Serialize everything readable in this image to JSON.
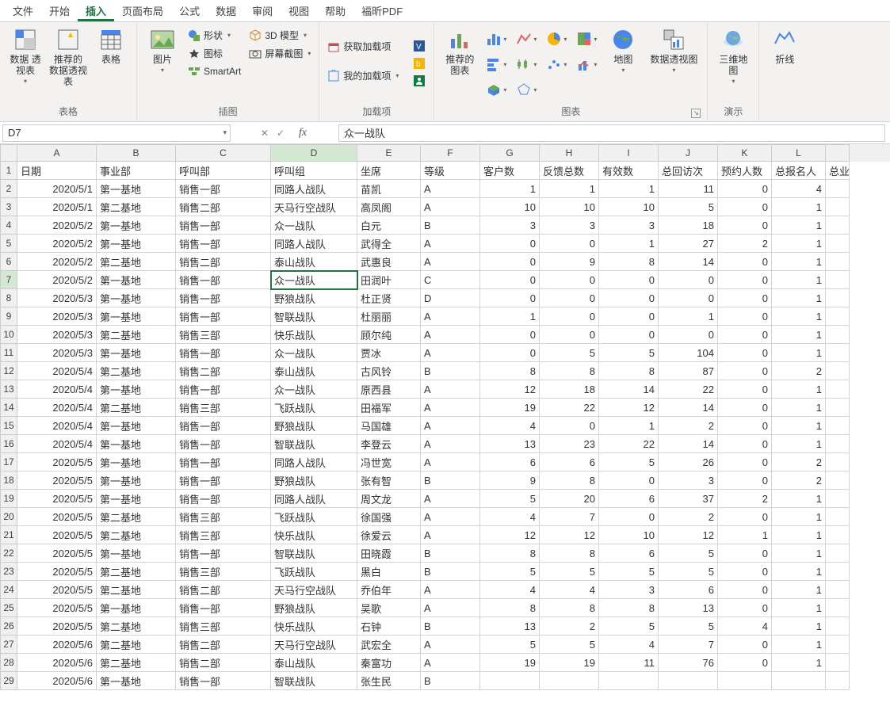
{
  "tabs": [
    "文件",
    "开始",
    "插入",
    "页面布局",
    "公式",
    "数据",
    "审阅",
    "视图",
    "帮助",
    "福昕PDF"
  ],
  "active_tab": 2,
  "groups": {
    "tables": {
      "label": "表格",
      "pivot": "数据\n透视表",
      "rec_pivot": "推荐的\n数据透视表",
      "table": "表格"
    },
    "illus": {
      "label": "插图",
      "pic": "图片",
      "shapes": "形状",
      "icons": "图标",
      "smartart": "SmartArt",
      "model": "3D 模型",
      "screenshot": "屏幕截图"
    },
    "addins": {
      "label": "加载项",
      "get": "获取加载项",
      "my": "我的加载项"
    },
    "charts": {
      "label": "图表",
      "rec": "推荐的\n图表",
      "map": "地图",
      "pivotchart": "数据透视图"
    },
    "demo": {
      "label": "演示",
      "globe": "三维地\n图"
    },
    "spark": {
      "line": "折线"
    }
  },
  "namebox": "D7",
  "formula": "众一战队",
  "columns": [
    "A",
    "B",
    "C",
    "D",
    "E",
    "F",
    "G",
    "H",
    "I",
    "J",
    "K",
    "L",
    ""
  ],
  "header_row": [
    "日期",
    "事业部",
    "呼叫部",
    "呼叫组",
    "坐席",
    "等级",
    "客户数",
    "反馈总数",
    "有效数",
    "总回访次",
    "预约人数",
    "总报名人",
    "总业"
  ],
  "active_cell": {
    "row": 7,
    "col": "D"
  },
  "rows": [
    {
      "n": 2,
      "d": [
        "2020/5/1",
        "第一基地",
        "销售一部",
        "同路人战队",
        "苗凯",
        "A",
        "1",
        "1",
        "1",
        "11",
        "0",
        "4",
        ""
      ]
    },
    {
      "n": 3,
      "d": [
        "2020/5/1",
        "第二基地",
        "销售二部",
        "天马行空战队",
        "高凤阁",
        "A",
        "10",
        "10",
        "10",
        "5",
        "0",
        "1",
        ""
      ]
    },
    {
      "n": 4,
      "d": [
        "2020/5/2",
        "第一基地",
        "销售一部",
        "众一战队",
        "白元",
        "B",
        "3",
        "3",
        "3",
        "18",
        "0",
        "1",
        ""
      ]
    },
    {
      "n": 5,
      "d": [
        "2020/5/2",
        "第一基地",
        "销售一部",
        "同路人战队",
        "武得全",
        "A",
        "0",
        "0",
        "1",
        "27",
        "2",
        "1",
        ""
      ]
    },
    {
      "n": 6,
      "d": [
        "2020/5/2",
        "第二基地",
        "销售二部",
        "泰山战队",
        "武惠良",
        "A",
        "0",
        "9",
        "8",
        "14",
        "0",
        "1",
        ""
      ]
    },
    {
      "n": 7,
      "d": [
        "2020/5/2",
        "第一基地",
        "销售一部",
        "众一战队",
        "田润叶",
        "C",
        "0",
        "0",
        "0",
        "0",
        "0",
        "1",
        ""
      ]
    },
    {
      "n": 8,
      "d": [
        "2020/5/3",
        "第一基地",
        "销售一部",
        "野狼战队",
        "杜正贤",
        "D",
        "0",
        "0",
        "0",
        "0",
        "0",
        "1",
        ""
      ]
    },
    {
      "n": 9,
      "d": [
        "2020/5/3",
        "第一基地",
        "销售一部",
        "智联战队",
        "杜丽丽",
        "A",
        "1",
        "0",
        "0",
        "1",
        "0",
        "1",
        ""
      ]
    },
    {
      "n": 10,
      "d": [
        "2020/5/3",
        "第二基地",
        "销售三部",
        "快乐战队",
        "顾尔纯",
        "A",
        "0",
        "0",
        "0",
        "0",
        "0",
        "1",
        ""
      ]
    },
    {
      "n": 11,
      "d": [
        "2020/5/3",
        "第一基地",
        "销售一部",
        "众一战队",
        "贾冰",
        "A",
        "0",
        "5",
        "5",
        "104",
        "0",
        "1",
        ""
      ]
    },
    {
      "n": 12,
      "d": [
        "2020/5/4",
        "第二基地",
        "销售二部",
        "泰山战队",
        "古风铃",
        "B",
        "8",
        "8",
        "8",
        "87",
        "0",
        "2",
        ""
      ]
    },
    {
      "n": 13,
      "d": [
        "2020/5/4",
        "第一基地",
        "销售一部",
        "众一战队",
        "原西县",
        "A",
        "12",
        "18",
        "14",
        "22",
        "0",
        "1",
        ""
      ]
    },
    {
      "n": 14,
      "d": [
        "2020/5/4",
        "第二基地",
        "销售三部",
        "飞跃战队",
        "田福军",
        "A",
        "19",
        "22",
        "12",
        "14",
        "0",
        "1",
        ""
      ]
    },
    {
      "n": 15,
      "d": [
        "2020/5/4",
        "第一基地",
        "销售一部",
        "野狼战队",
        "马国雄",
        "A",
        "4",
        "0",
        "1",
        "2",
        "0",
        "1",
        ""
      ]
    },
    {
      "n": 16,
      "d": [
        "2020/5/4",
        "第一基地",
        "销售一部",
        "智联战队",
        "李登云",
        "A",
        "13",
        "23",
        "22",
        "14",
        "0",
        "1",
        ""
      ]
    },
    {
      "n": 17,
      "d": [
        "2020/5/5",
        "第一基地",
        "销售一部",
        "同路人战队",
        "冯世宽",
        "A",
        "6",
        "6",
        "5",
        "26",
        "0",
        "2",
        ""
      ]
    },
    {
      "n": 18,
      "d": [
        "2020/5/5",
        "第一基地",
        "销售一部",
        "野狼战队",
        "张有智",
        "B",
        "9",
        "8",
        "0",
        "3",
        "0",
        "2",
        ""
      ]
    },
    {
      "n": 19,
      "d": [
        "2020/5/5",
        "第一基地",
        "销售一部",
        "同路人战队",
        "周文龙",
        "A",
        "5",
        "20",
        "6",
        "37",
        "2",
        "1",
        ""
      ]
    },
    {
      "n": 20,
      "d": [
        "2020/5/5",
        "第二基地",
        "销售三部",
        "飞跃战队",
        "徐国强",
        "A",
        "4",
        "7",
        "0",
        "2",
        "0",
        "1",
        ""
      ]
    },
    {
      "n": 21,
      "d": [
        "2020/5/5",
        "第二基地",
        "销售三部",
        "快乐战队",
        "徐爱云",
        "A",
        "12",
        "12",
        "10",
        "12",
        "1",
        "1",
        ""
      ]
    },
    {
      "n": 22,
      "d": [
        "2020/5/5",
        "第一基地",
        "销售一部",
        "智联战队",
        "田晓霞",
        "B",
        "8",
        "8",
        "6",
        "5",
        "0",
        "1",
        ""
      ]
    },
    {
      "n": 23,
      "d": [
        "2020/5/5",
        "第二基地",
        "销售三部",
        "飞跃战队",
        "黑白",
        "B",
        "5",
        "5",
        "5",
        "5",
        "0",
        "1",
        ""
      ]
    },
    {
      "n": 24,
      "d": [
        "2020/5/5",
        "第二基地",
        "销售二部",
        "天马行空战队",
        "乔伯年",
        "A",
        "4",
        "4",
        "3",
        "6",
        "0",
        "1",
        ""
      ]
    },
    {
      "n": 25,
      "d": [
        "2020/5/5",
        "第一基地",
        "销售一部",
        "野狼战队",
        "吴歌",
        "A",
        "8",
        "8",
        "8",
        "13",
        "0",
        "1",
        ""
      ]
    },
    {
      "n": 26,
      "d": [
        "2020/5/5",
        "第二基地",
        "销售三部",
        "快乐战队",
        "石钟",
        "B",
        "13",
        "2",
        "5",
        "5",
        "4",
        "1",
        ""
      ]
    },
    {
      "n": 27,
      "d": [
        "2020/5/6",
        "第二基地",
        "销售二部",
        "天马行空战队",
        "武宏全",
        "A",
        "5",
        "5",
        "4",
        "7",
        "0",
        "1",
        ""
      ]
    },
    {
      "n": 28,
      "d": [
        "2020/5/6",
        "第二基地",
        "销售二部",
        "泰山战队",
        "秦富功",
        "A",
        "19",
        "19",
        "11",
        "76",
        "0",
        "1",
        ""
      ]
    },
    {
      "n": 29,
      "d": [
        "2020/5/6",
        "第一基地",
        "销售一部",
        "智联战队",
        "张生民",
        "B",
        "",
        "",
        "",
        "",
        "",
        "",
        ""
      ]
    }
  ]
}
